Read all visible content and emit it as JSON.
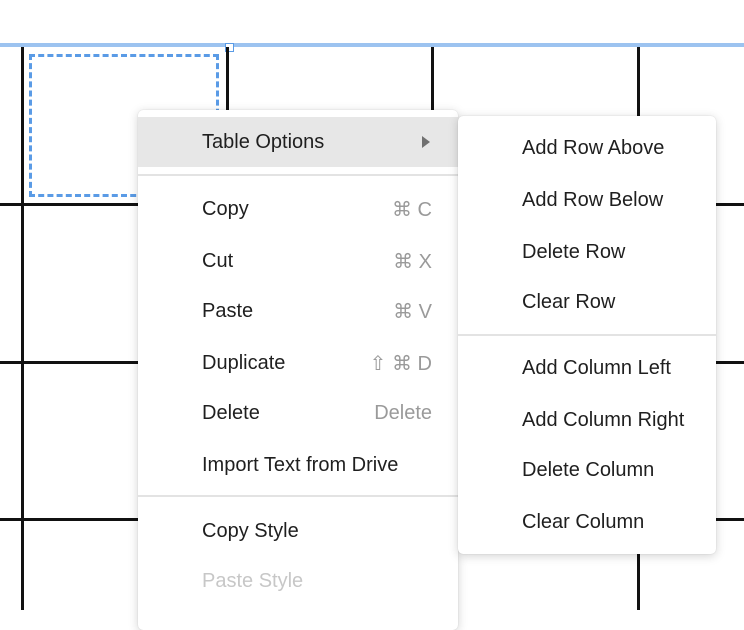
{
  "context_menu": {
    "items": [
      {
        "label": "Table Options",
        "shortcut": "",
        "has_submenu": true
      },
      {
        "label": "Copy",
        "shortcut": "⌘ C"
      },
      {
        "label": "Cut",
        "shortcut": "⌘ X"
      },
      {
        "label": "Paste",
        "shortcut": "⌘ V"
      },
      {
        "label": "Duplicate",
        "shortcut": "⇧ ⌘ D"
      },
      {
        "label": "Delete",
        "shortcut": "Delete"
      },
      {
        "label": "Import Text from Drive",
        "shortcut": ""
      },
      {
        "label": "Copy Style",
        "shortcut": ""
      },
      {
        "label": "Paste Style",
        "shortcut": "",
        "disabled": true
      }
    ]
  },
  "submenu": {
    "items": [
      {
        "label": "Add Row Above"
      },
      {
        "label": "Add Row Below"
      },
      {
        "label": "Delete Row"
      },
      {
        "label": "Clear Row"
      },
      {
        "label": "Add Column Left"
      },
      {
        "label": "Add Column Right"
      },
      {
        "label": "Delete Column"
      },
      {
        "label": "Clear Column"
      }
    ]
  },
  "colors": {
    "selection": "#5a9be6",
    "highlight": "#e7e7e7",
    "shortcut_text": "#9a9a9a",
    "disabled_text": "#c7c7c7"
  },
  "icons": {
    "submenu_arrow": "chevron-right-icon"
  }
}
